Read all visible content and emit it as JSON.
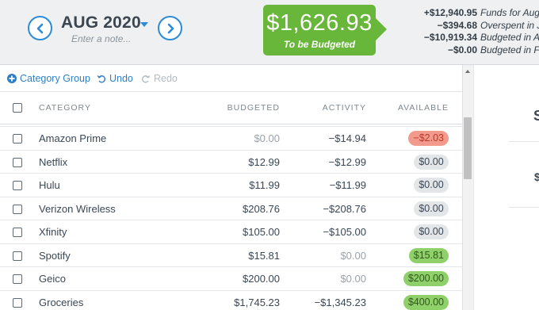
{
  "header": {
    "month": "AUG 2020",
    "note_placeholder": "Enter a note...",
    "to_be_budgeted": {
      "amount": "$1,626.93",
      "label": "To be Budgeted"
    },
    "breakdown": [
      {
        "amount": "+$12,940.95",
        "label": "Funds for Aug"
      },
      {
        "amount": "−$394.68",
        "label": "Overspent in Jul"
      },
      {
        "amount": "−$10,919.34",
        "label": "Budgeted in Aug"
      },
      {
        "amount": "−$0.00",
        "label": "Budgeted in Future"
      }
    ]
  },
  "toolbar": {
    "category_group": "Category Group",
    "undo": "Undo",
    "redo": "Redo"
  },
  "table": {
    "columns": {
      "category": "CATEGORY",
      "budgeted": "BUDGETED",
      "activity": "ACTIVITY",
      "available": "AVAILABLE"
    },
    "rows": [
      {
        "category": "Amazon Prime",
        "budgeted": "$0.00",
        "activity": "−$14.94",
        "available": "−$2.03",
        "status": "negative"
      },
      {
        "category": "Netflix",
        "budgeted": "$12.99",
        "activity": "−$12.99",
        "available": "$0.00",
        "status": "zero"
      },
      {
        "category": "Hulu",
        "budgeted": "$11.99",
        "activity": "−$11.99",
        "available": "$0.00",
        "status": "zero"
      },
      {
        "category": "Verizon Wireless",
        "budgeted": "$208.76",
        "activity": "−$208.76",
        "available": "$0.00",
        "status": "zero"
      },
      {
        "category": "Xfinity",
        "budgeted": "$105.00",
        "activity": "−$105.00",
        "available": "$0.00",
        "status": "zero"
      },
      {
        "category": "Spotify",
        "budgeted": "$15.81",
        "activity": "$0.00",
        "available": "$15.81",
        "status": "positive"
      },
      {
        "category": "Geico",
        "budgeted": "$200.00",
        "activity": "$0.00",
        "available": "$200.00",
        "status": "positive"
      },
      {
        "category": "Groceries",
        "budgeted": "$1,745.23",
        "activity": "−$1,345.23",
        "available": "$400.00",
        "status": "positive"
      }
    ]
  },
  "inspector": {
    "glyph_top": "S",
    "glyph_mid": "$"
  },
  "colors": {
    "accent": "#2e8bd8",
    "to_be_budgeted_bg": "#68b63a",
    "negative_pill": "#f29a8c",
    "zero_pill": "#e3e6e9",
    "positive_pill": "#8fd06a"
  },
  "icons": {
    "prev_month": "chevron-left-circle-icon",
    "next_month": "chevron-right-circle-icon",
    "add": "plus-circle-icon",
    "undo": "undo-icon",
    "redo": "redo-icon"
  }
}
